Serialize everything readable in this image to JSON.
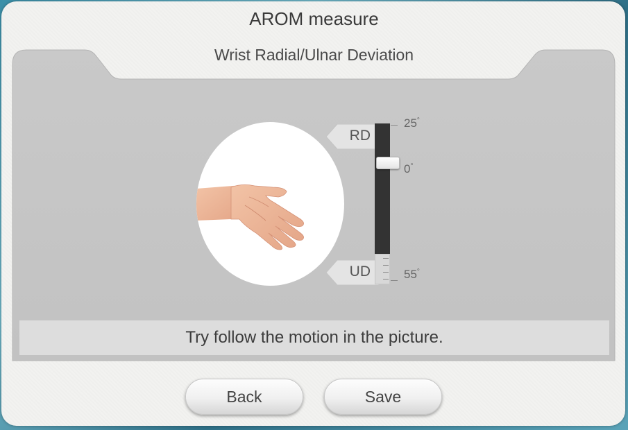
{
  "header": {
    "title": "AROM measure",
    "subtitle": "Wrist Radial/Ulnar Deviation"
  },
  "figure": {
    "image": "hand-wrist-motion-illustration"
  },
  "gauge": {
    "top_label": "RD",
    "bottom_label": "UD",
    "max_label": "25",
    "zero_label": "0",
    "min_label": "55",
    "degree_symbol": "°",
    "current_value_deg": 0
  },
  "instruction": {
    "text": "Try follow the motion in the picture."
  },
  "buttons": {
    "back": "Back",
    "save": "Save"
  },
  "colors": {
    "panel": "#c8c8c8",
    "frame": "#f2f2f0",
    "gauge_bar": "#333333",
    "background_teal": "#3b8fa8"
  }
}
